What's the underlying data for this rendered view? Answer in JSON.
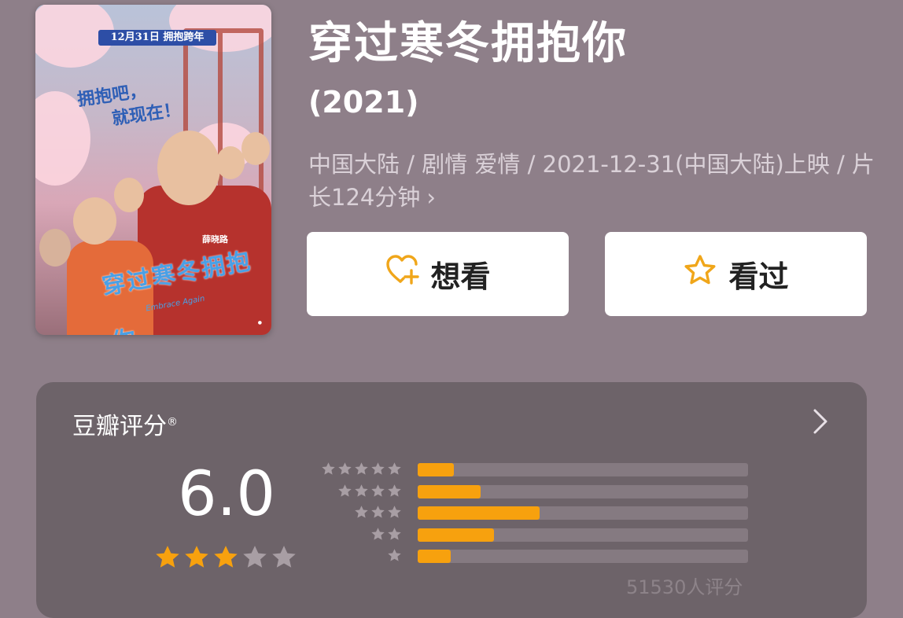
{
  "poster": {
    "ribbon": "12月31日 拥抱跨年",
    "slogan_line1": "拥抱吧，",
    "slogan_line2": "就现在！",
    "title_art": "穿过寒冬拥抱你",
    "subtitle_art": "Embrace Again",
    "name_tag": "薛晓路"
  },
  "movie": {
    "title": "穿过寒冬拥抱你",
    "year": "(2021)",
    "meta": "中国大陆 / 剧情 爱情 / 2021-12-31(中国大陆)上映 / 片长124分钟",
    "meta_chevron": "›"
  },
  "actions": {
    "want_label": "想看",
    "seen_label": "看过",
    "want_icon": "heart-plus-icon",
    "seen_icon": "star-outline-icon"
  },
  "rating": {
    "title": "豆瓣评分",
    "registered_mark": "®",
    "score": "6.0",
    "stars_filled": 3,
    "stars_total": 5,
    "count_text": "51530人评分",
    "distribution": [
      {
        "stars": 5,
        "fraction": 0.11
      },
      {
        "stars": 4,
        "fraction": 0.19
      },
      {
        "stars": 3,
        "fraction": 0.37
      },
      {
        "stars": 2,
        "fraction": 0.23
      },
      {
        "stars": 1,
        "fraction": 0.1
      }
    ]
  },
  "colors": {
    "background": "#8e7f89",
    "card": "#6d6369",
    "accent": "#f7a10e",
    "icon_accent": "#f0a61a"
  }
}
